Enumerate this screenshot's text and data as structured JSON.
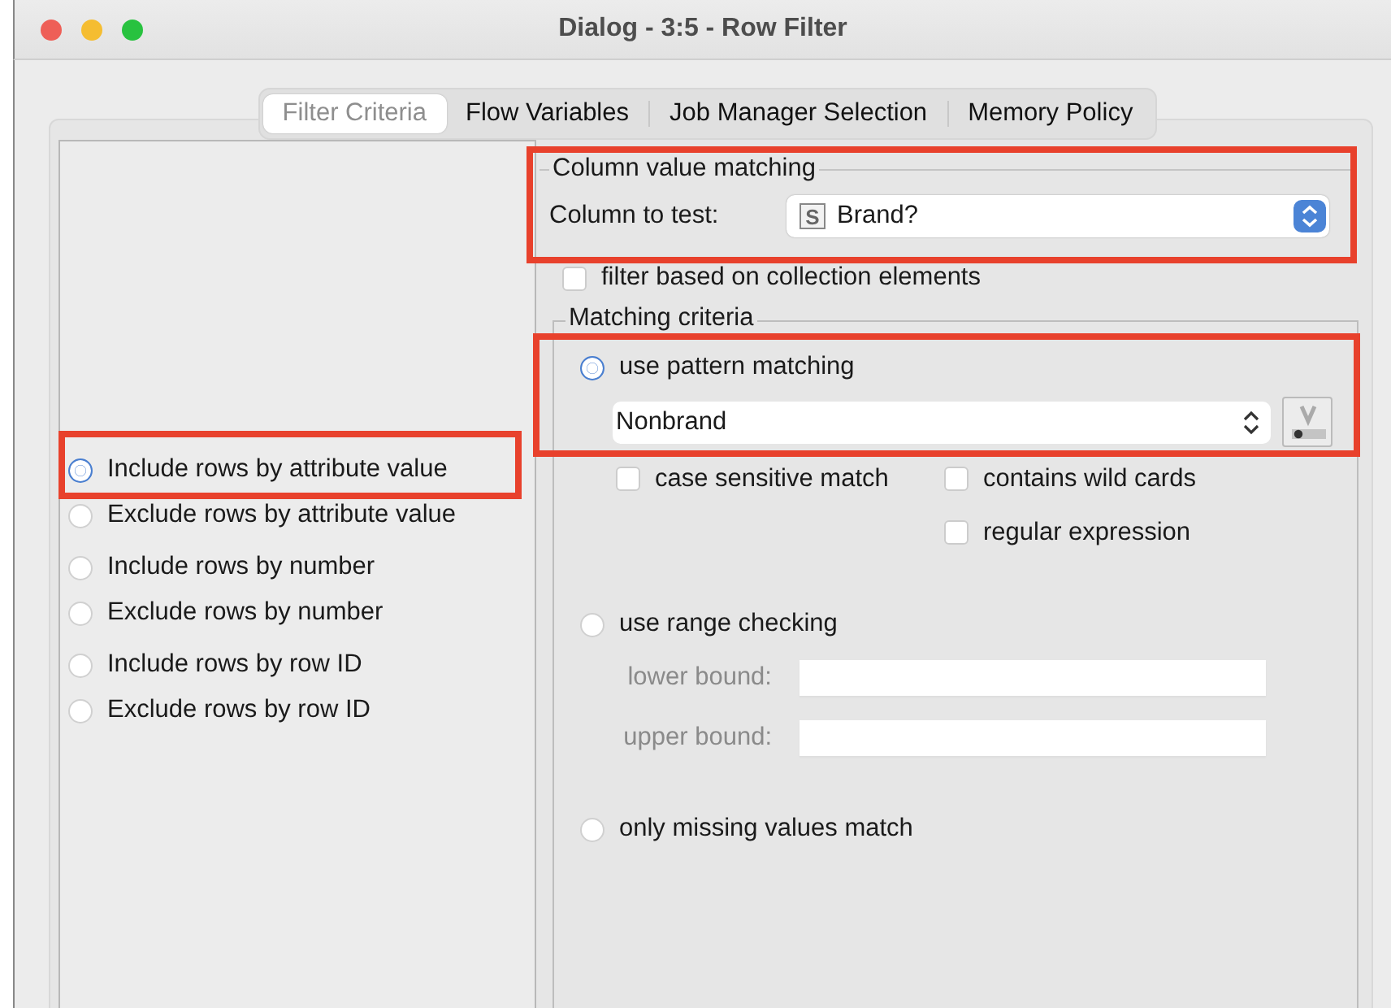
{
  "window": {
    "title": "Dialog - 3:5 - Row Filter"
  },
  "tabs": [
    {
      "label": "Filter Criteria",
      "selected": true
    },
    {
      "label": "Flow Variables",
      "selected": false
    },
    {
      "label": "Job Manager Selection",
      "selected": false
    },
    {
      "label": "Memory Policy",
      "selected": false
    }
  ],
  "mode_options": [
    {
      "label": "Include rows by attribute value",
      "selected": true,
      "highlighted": true
    },
    {
      "label": "Exclude rows by attribute value",
      "selected": false,
      "highlighted": false
    },
    {
      "label": "Include rows by number",
      "selected": false,
      "highlighted": false
    },
    {
      "label": "Exclude rows by number",
      "selected": false,
      "highlighted": false
    },
    {
      "label": "Include rows by row ID",
      "selected": false,
      "highlighted": false
    },
    {
      "label": "Exclude rows by row ID",
      "selected": false,
      "highlighted": false
    }
  ],
  "column_value_matching": {
    "highlighted": true,
    "title": "Column value matching",
    "column_label": "Column to test:",
    "column_type": "S",
    "column_value": "Brand?",
    "collection_filter": {
      "label": "filter based on collection elements",
      "checked": false
    }
  },
  "matching_criteria": {
    "title": "Matching criteria",
    "pattern": {
      "highlighted": true,
      "label": "use pattern matching",
      "selected": true,
      "value": "Nonbrand",
      "options": [
        {
          "label": "case sensitive match",
          "checked": false
        },
        {
          "label": "contains wild cards",
          "checked": false
        },
        {
          "label": "regular expression",
          "checked": false
        }
      ]
    },
    "range": {
      "label": "use range checking",
      "selected": false,
      "lower_label": "lower bound:",
      "upper_label": "upper bound:"
    },
    "missing": {
      "label": "only missing values match",
      "selected": false
    }
  }
}
